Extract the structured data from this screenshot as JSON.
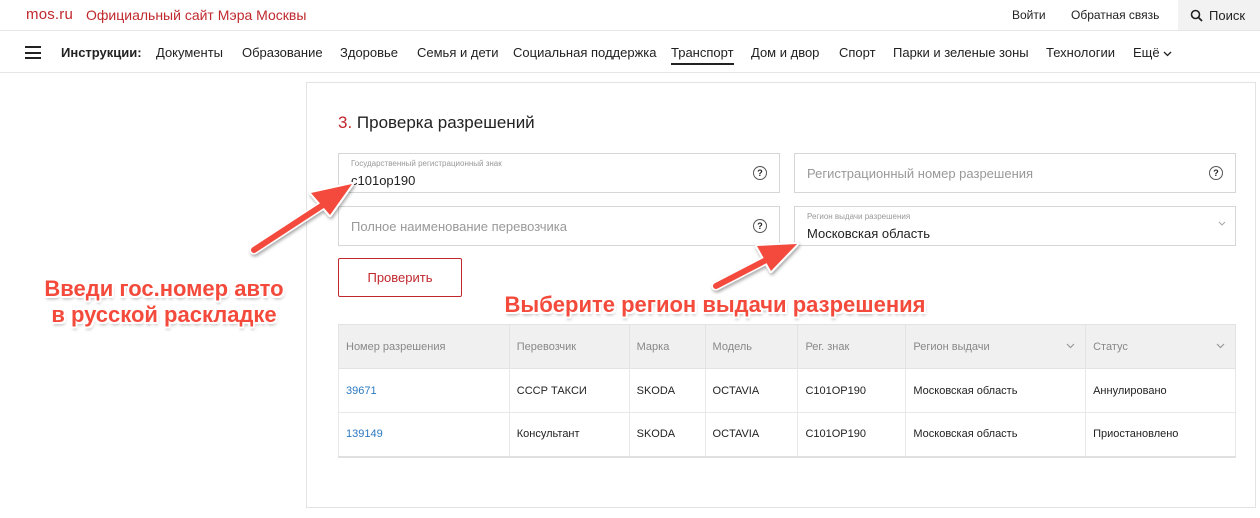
{
  "topbar": {
    "logo": "mos.ru",
    "official": "Официальный сайт Мэра Москвы",
    "login": "Войти",
    "feedback": "Обратная связь",
    "search": "Поиск"
  },
  "nav": {
    "label": "Инструкции:",
    "items": [
      "Документы",
      "Образование",
      "Здоровье",
      "Семья и дети",
      "Социальная поддержка",
      "Транспорт",
      "Дом и двор",
      "Спорт",
      "Парки и зеленые зоны",
      "Технологии"
    ],
    "active": "Транспорт",
    "more": "Ещё"
  },
  "section": {
    "number": "3.",
    "title": "Проверка разрешений"
  },
  "form": {
    "plate_label": "Государственный регистрационный знак",
    "plate_value": "с101ор190",
    "permit_placeholder": "Регистрационный номер разрешения",
    "carrier_placeholder": "Полное наименование перевозчика",
    "region_label": "Регион выдачи разрешения",
    "region_value": "Московская область",
    "help": "?",
    "check_button": "Проверить"
  },
  "table": {
    "headers": [
      "Номер разрешения",
      "Перевозчик",
      "Марка",
      "Модель",
      "Рег. знак",
      "Регион выдачи",
      "Статус"
    ],
    "rows": [
      [
        "39671",
        "СССР ТАКСИ",
        "SKODA",
        "OCTAVIA",
        "С101ОР190",
        "Московская область",
        "Аннулировано"
      ],
      [
        "139149",
        "Консультант",
        "SKODA",
        "OCTAVIA",
        "С101ОР190",
        "Московская область",
        "Приостановлено"
      ]
    ]
  },
  "annotations": {
    "left_line1": "Введи гос.номер авто",
    "left_line2": "в русской раскладке",
    "right": "Выберите регион выдачи разрешения"
  },
  "colors": {
    "brand": "#c0282d",
    "link": "#2b79c2",
    "annotation": "#f44a3c"
  }
}
